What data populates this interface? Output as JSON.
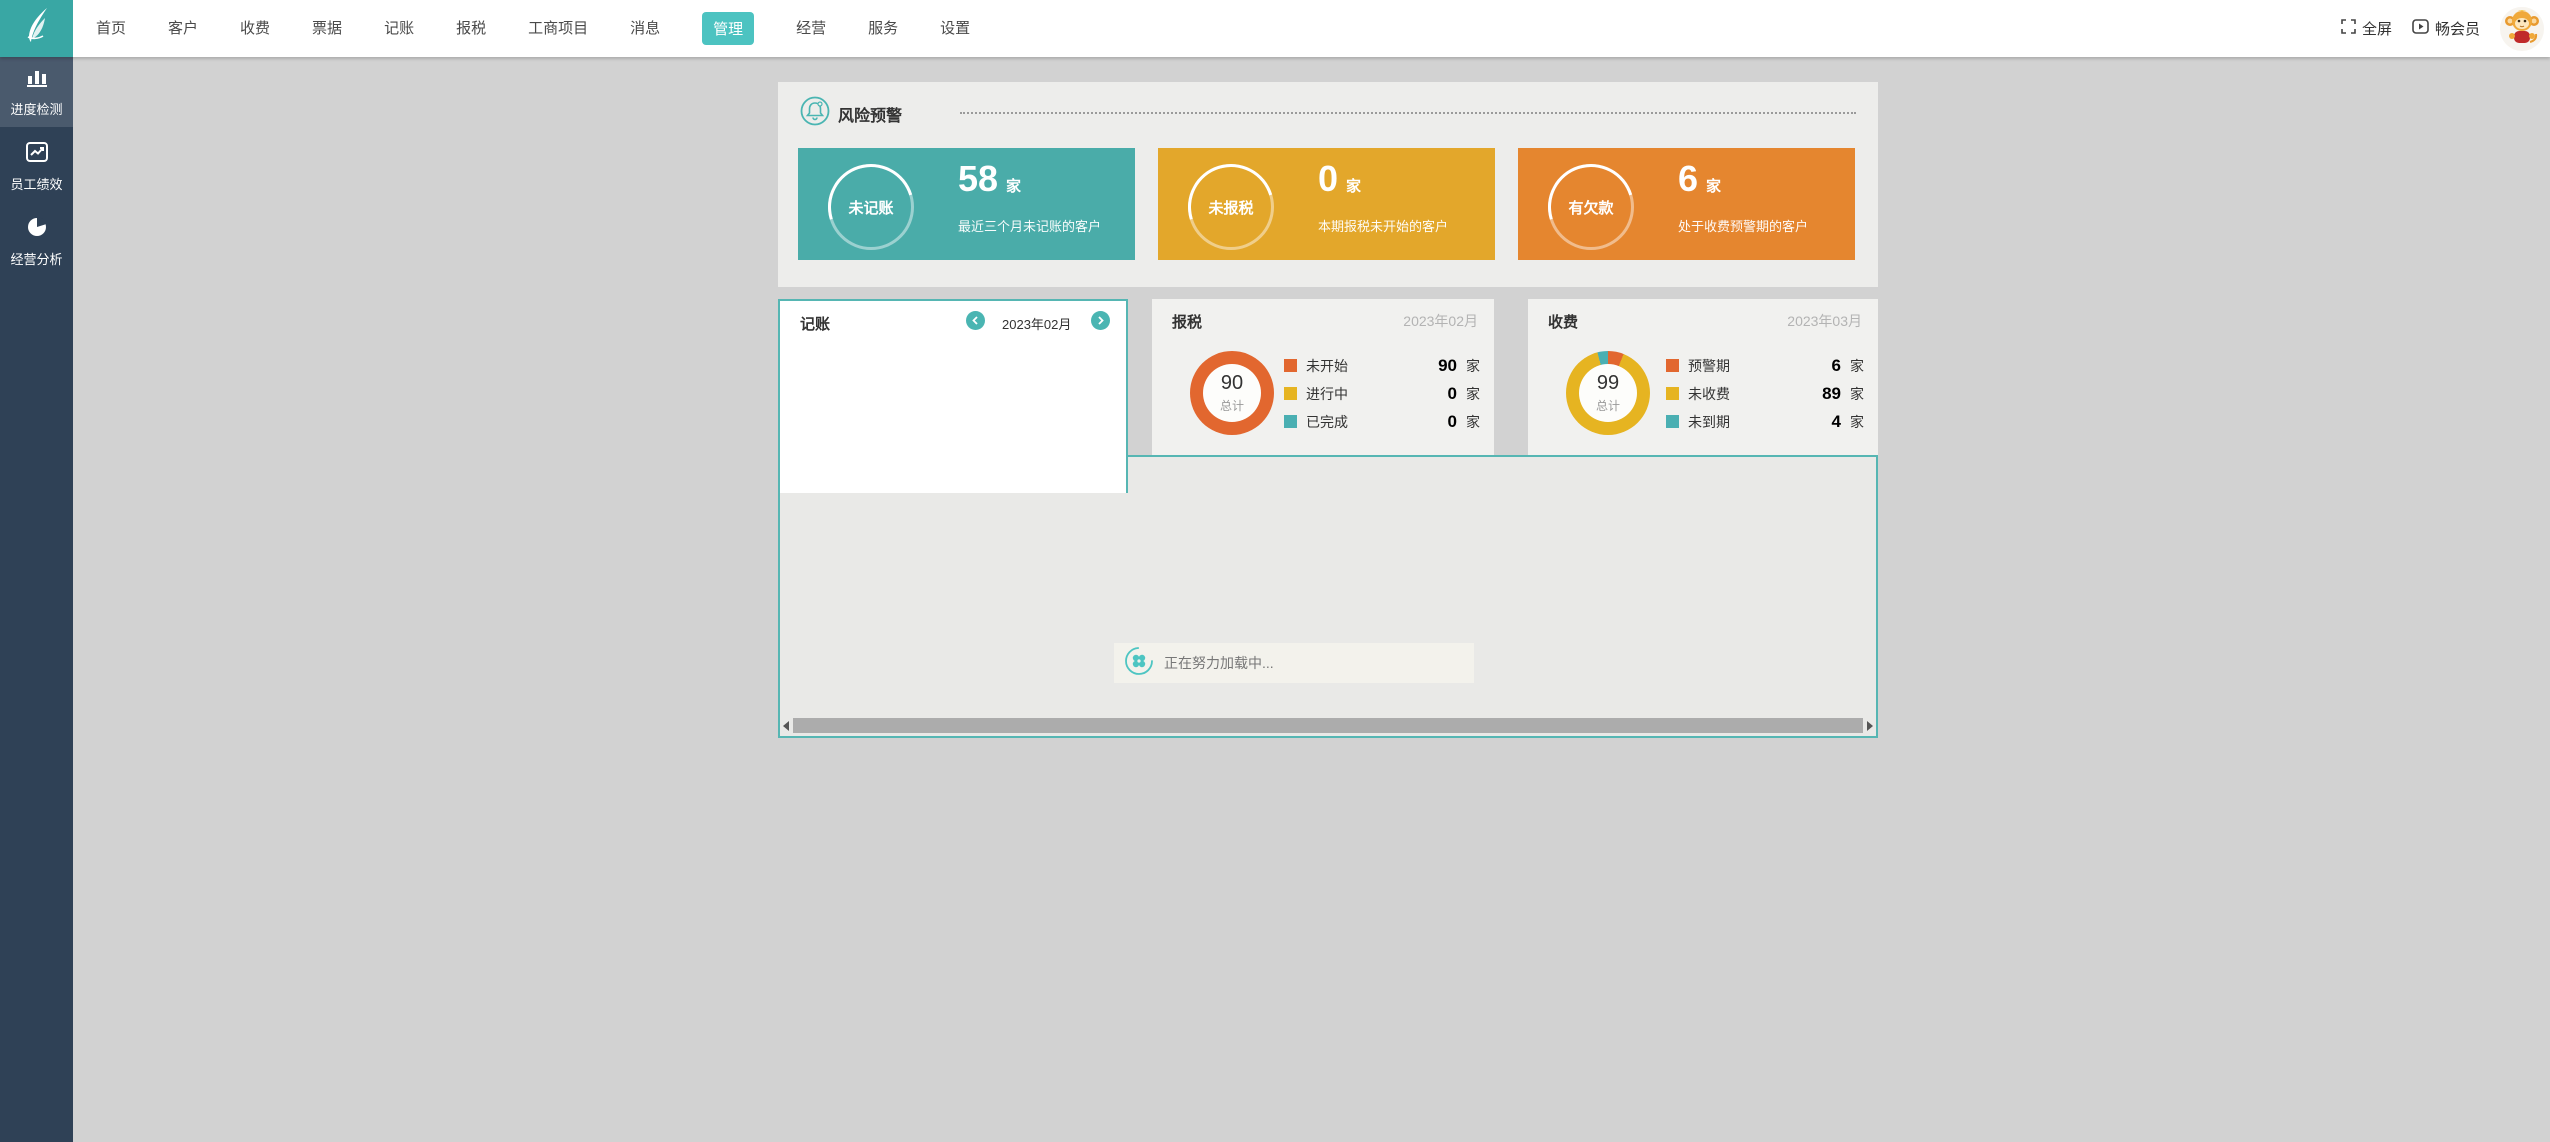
{
  "nav": {
    "logo_icon": "feather-icon",
    "items": [
      {
        "label": "首页"
      },
      {
        "label": "客户"
      },
      {
        "label": "收费"
      },
      {
        "label": "票据"
      },
      {
        "label": "记账"
      },
      {
        "label": "报税"
      },
      {
        "label": "工商项目"
      },
      {
        "label": "消息"
      },
      {
        "label": "管理",
        "active": true
      },
      {
        "label": "经营"
      },
      {
        "label": "服务"
      },
      {
        "label": "设置"
      }
    ],
    "fullscreen": {
      "icon": "fullscreen-icon",
      "label": "全屏"
    },
    "member": {
      "icon": "video-play-icon",
      "label": "畅会员"
    },
    "avatar_icon": "monkey-avatar"
  },
  "sidebar": {
    "items": [
      {
        "icon": "bar-chart-icon",
        "label": "进度检测",
        "active": true
      },
      {
        "icon": "line-chart-icon",
        "label": "员工绩效",
        "active": false
      },
      {
        "icon": "pie-chart-icon",
        "label": "经营分析",
        "active": false
      }
    ]
  },
  "risk": {
    "icon": "bell-icon",
    "title": "风险预警",
    "cards": [
      {
        "label": "未记账",
        "value": "58",
        "unit": "家",
        "desc": "最近三个月未记账的客户",
        "color": "#4aaca9"
      },
      {
        "label": "未报税",
        "value": "0",
        "unit": "家",
        "desc": "本期报税未开始的客户",
        "color": "#e3a72b"
      },
      {
        "label": "有欠款",
        "value": "6",
        "unit": "家",
        "desc": "处于收费预警期的客户",
        "color": "#e5862f"
      }
    ]
  },
  "tabs": {
    "jizhang": {
      "title": "记账",
      "period": "2023年02月"
    },
    "baoshui": {
      "title": "报税",
      "period": "2023年02月",
      "total": "90",
      "total_label": "总计",
      "legend": [
        {
          "label": "未开始",
          "value": "90",
          "unit": "家",
          "color": "#e2672f"
        },
        {
          "label": "进行中",
          "value": "0",
          "unit": "家",
          "color": "#e6b421"
        },
        {
          "label": "已完成",
          "value": "0",
          "unit": "家",
          "color": "#4aafb2"
        }
      ]
    },
    "shoufei": {
      "title": "收费",
      "period": "2023年03月",
      "total": "99",
      "total_label": "总计",
      "legend": [
        {
          "label": "预警期",
          "value": "6",
          "unit": "家",
          "color": "#e2672f"
        },
        {
          "label": "未收费",
          "value": "89",
          "unit": "家",
          "color": "#e6b421"
        },
        {
          "label": "未到期",
          "value": "4",
          "unit": "家",
          "color": "#4aafb2"
        }
      ]
    }
  },
  "content": {
    "loading_icon": "spinner-icon",
    "loading_text": "正在努力加载中..."
  },
  "colors": {
    "accent_teal": "#4cc3c1",
    "tab_border": "#56b6b3",
    "sidebar_bg": "#2f4156",
    "sidebar_active_bg": "#4a5a6d",
    "page_bg": "#d2d2d2",
    "panel_bg": "#ededeb",
    "content_bg": "#e9e9e7"
  }
}
